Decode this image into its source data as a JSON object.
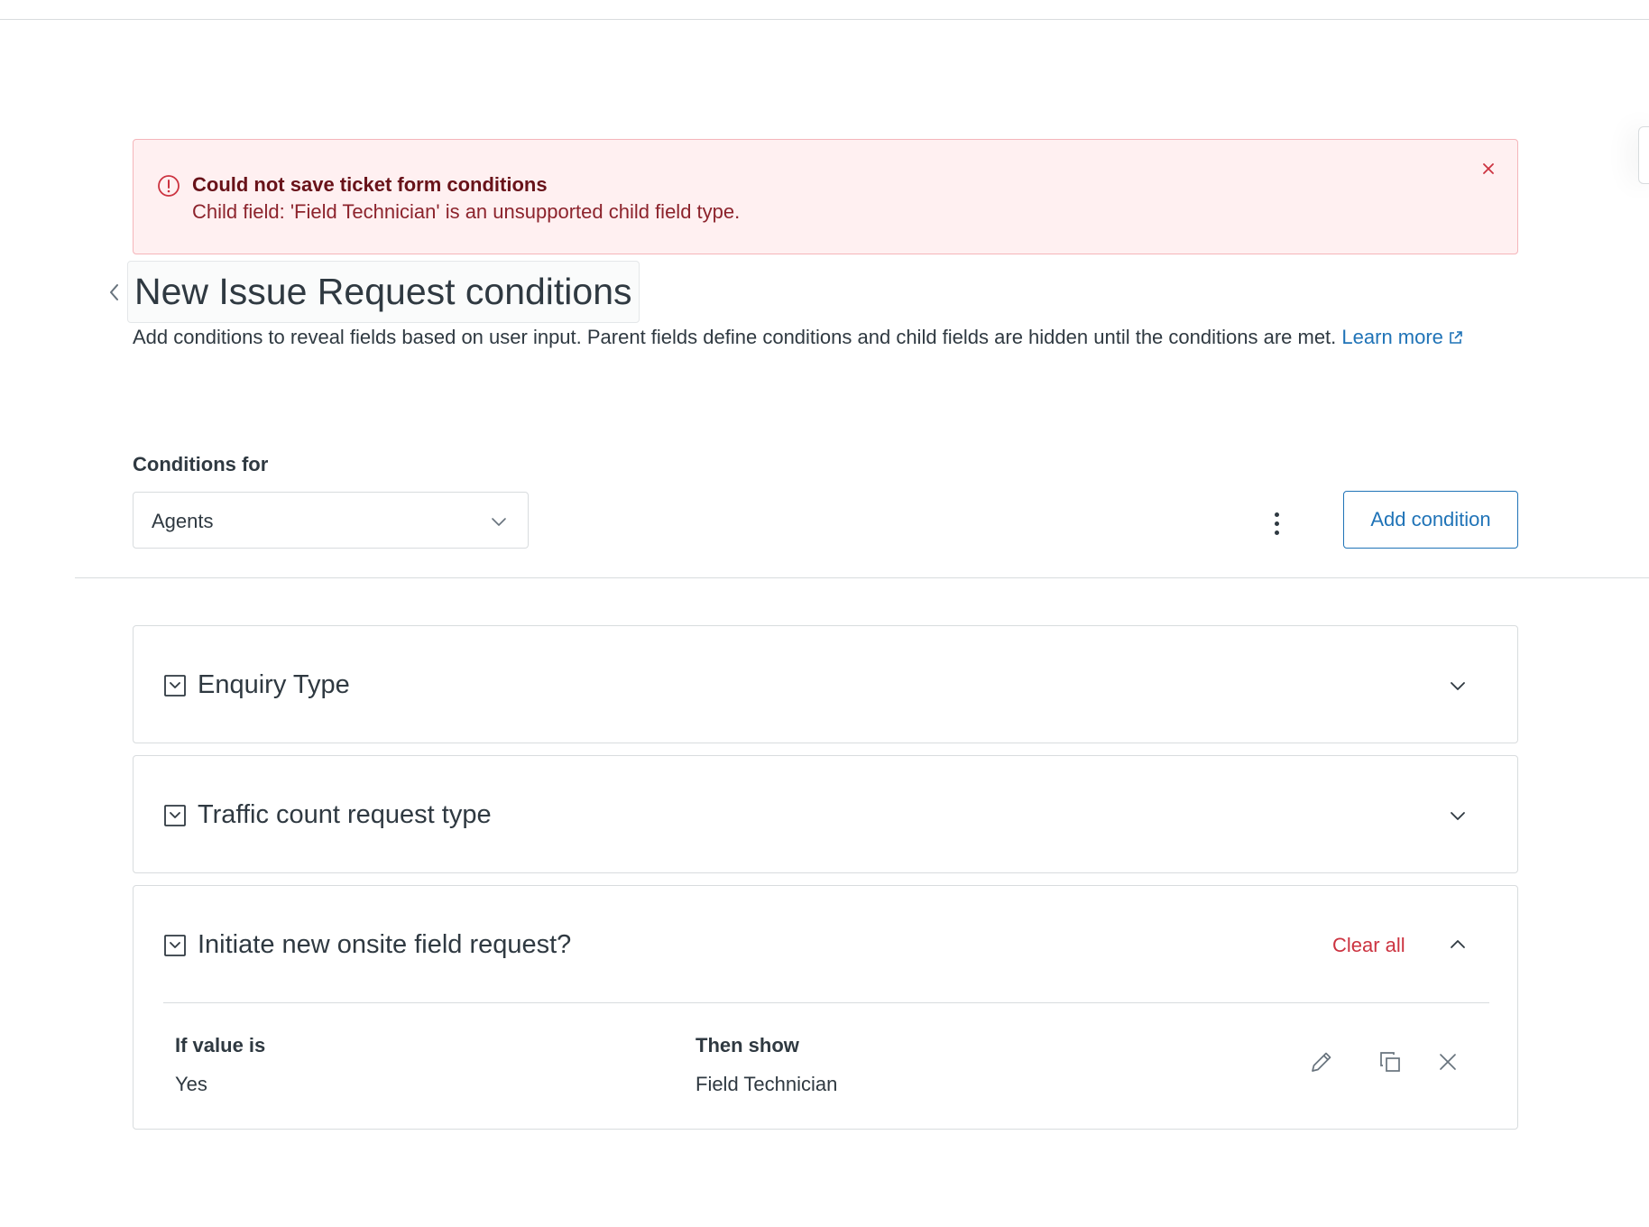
{
  "alert": {
    "title": "Could not save ticket form conditions",
    "message": "Child field: 'Field Technician' is an unsupported child field type.",
    "color_bg": "#fff0f1",
    "color_text": "#681219"
  },
  "header": {
    "title": "New Issue Request conditions",
    "description": "Add conditions to reveal fields based on user input. Parent fields define conditions and child fields are hidden until the conditions are met.",
    "learn_more": "Learn more"
  },
  "conditions_for": {
    "label": "Conditions for",
    "selected": "Agents"
  },
  "toolbar": {
    "add_condition": "Add condition"
  },
  "panels": [
    {
      "title": "Enquiry Type",
      "expanded": false
    },
    {
      "title": "Traffic count request type",
      "expanded": false
    },
    {
      "title": "Initiate new onsite field request?",
      "expanded": true,
      "clear_all": "Clear all",
      "columns": {
        "if_value": "If value is",
        "then_show": "Then show"
      },
      "rows": [
        {
          "if_value": "Yes",
          "then_show": "Field Technician"
        }
      ]
    }
  ],
  "colors": {
    "accent": "#1f73b7",
    "danger": "#cc3340",
    "text": "#2f3941",
    "border": "#d8dcde"
  },
  "icons": {
    "alert": "alert-circle-icon",
    "back": "chevron-left-icon",
    "external": "external-link-icon",
    "select": "chevron-down-icon",
    "more": "kebab-icon",
    "field": "dropdown-field-icon",
    "edit": "pencil-icon",
    "copy": "copy-icon",
    "delete": "close-icon"
  }
}
